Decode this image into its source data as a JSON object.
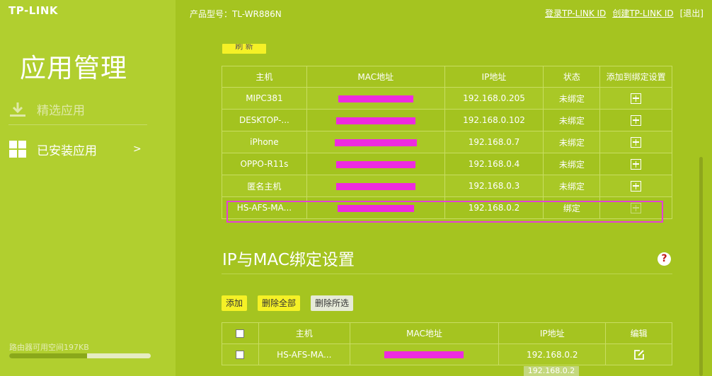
{
  "brand": {
    "logo": "TP-LINK"
  },
  "sidebar": {
    "title": "应用管理",
    "items": [
      {
        "label": "精选应用",
        "icon": "download-icon"
      },
      {
        "label": "已安装应用",
        "icon": "grid-icon",
        "chevron": ">"
      }
    ],
    "storage": {
      "label": "路由器可用空间197KB",
      "used_fraction": 0.55
    }
  },
  "header": {
    "model": "产品型号：TL-WR886N",
    "login": "登录TP-LINK ID",
    "create": "创建TP-LINK ID",
    "logout": "[退出]"
  },
  "host_list": {
    "refresh_label": "刷 新",
    "columns": [
      "主机",
      "MAC地址",
      "IP地址",
      "状态",
      "添加到绑定设置"
    ],
    "rows": [
      {
        "host": "MIPC381",
        "ip": "192.168.0.205",
        "status": "未绑定"
      },
      {
        "host": "DESKTOP-...",
        "ip": "192.168.0.102",
        "status": "未绑定"
      },
      {
        "host": "iPhone",
        "ip": "192.168.0.7",
        "status": "未绑定"
      },
      {
        "host": "OPPO-R11s",
        "ip": "192.168.0.4",
        "status": "未绑定"
      },
      {
        "host": "匿名主机",
        "ip": "192.168.0.3",
        "status": "未绑定"
      },
      {
        "host": "HS-AFS-MA...",
        "ip": "192.168.0.2",
        "status": "绑定"
      }
    ]
  },
  "binding": {
    "title": "IP与MAC绑定设置",
    "help": "?",
    "buttons": {
      "add": "添加",
      "delete_all": "删除全部",
      "delete_selected": "删除所选"
    },
    "columns": [
      "主机",
      "MAC地址",
      "IP地址",
      "编辑"
    ],
    "rows": [
      {
        "host": "HS-AFS-MA...",
        "ip": "192.168.0.2"
      }
    ],
    "overflow_ip": "192.168.0.2"
  },
  "colors": {
    "background": "#a5c420",
    "sidebar": "#b1cf2f",
    "button_yellow": "#f5f126",
    "redaction": "#ee2bdf"
  }
}
